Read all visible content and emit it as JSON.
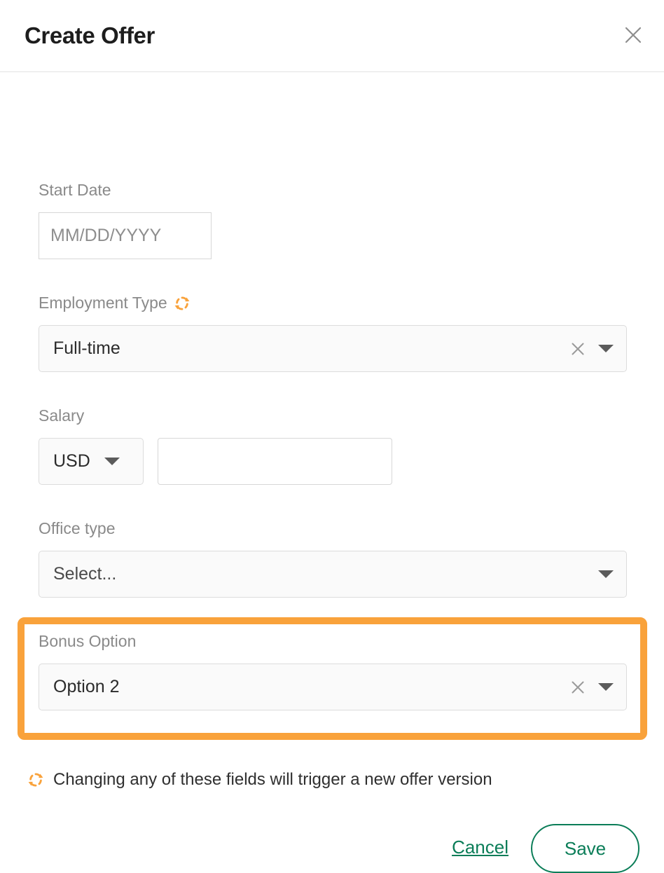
{
  "modal": {
    "title": "Create Offer",
    "close_icon": "close-icon"
  },
  "fields": {
    "start_date": {
      "label": "Start Date",
      "placeholder": "MM/DD/YYYY",
      "value": ""
    },
    "employment_type": {
      "label": "Employment Type",
      "value": "Full-time",
      "sync_icon": "sync-icon",
      "clear_icon": "clear-icon",
      "caret_icon": "chevron-down-icon"
    },
    "salary": {
      "label": "Salary",
      "currency": "USD",
      "amount": "",
      "caret_icon": "chevron-down-icon"
    },
    "office_type": {
      "label": "Office type",
      "value": "Select...",
      "caret_icon": "chevron-down-icon"
    },
    "bonus_option": {
      "label": "Bonus Option",
      "value": "Option 2",
      "clear_icon": "clear-icon",
      "caret_icon": "chevron-down-icon",
      "highlighted": true
    }
  },
  "footnote": {
    "icon": "sync-icon",
    "text": "Changing any of these fields will trigger a new offer version"
  },
  "actions": {
    "cancel_label": "Cancel",
    "save_label": "Save"
  },
  "colors": {
    "accent_orange": "#f9a23b",
    "accent_green": "#0b7d58",
    "label_grey": "#8a8a8a",
    "border_grey": "#dcdcdc"
  }
}
